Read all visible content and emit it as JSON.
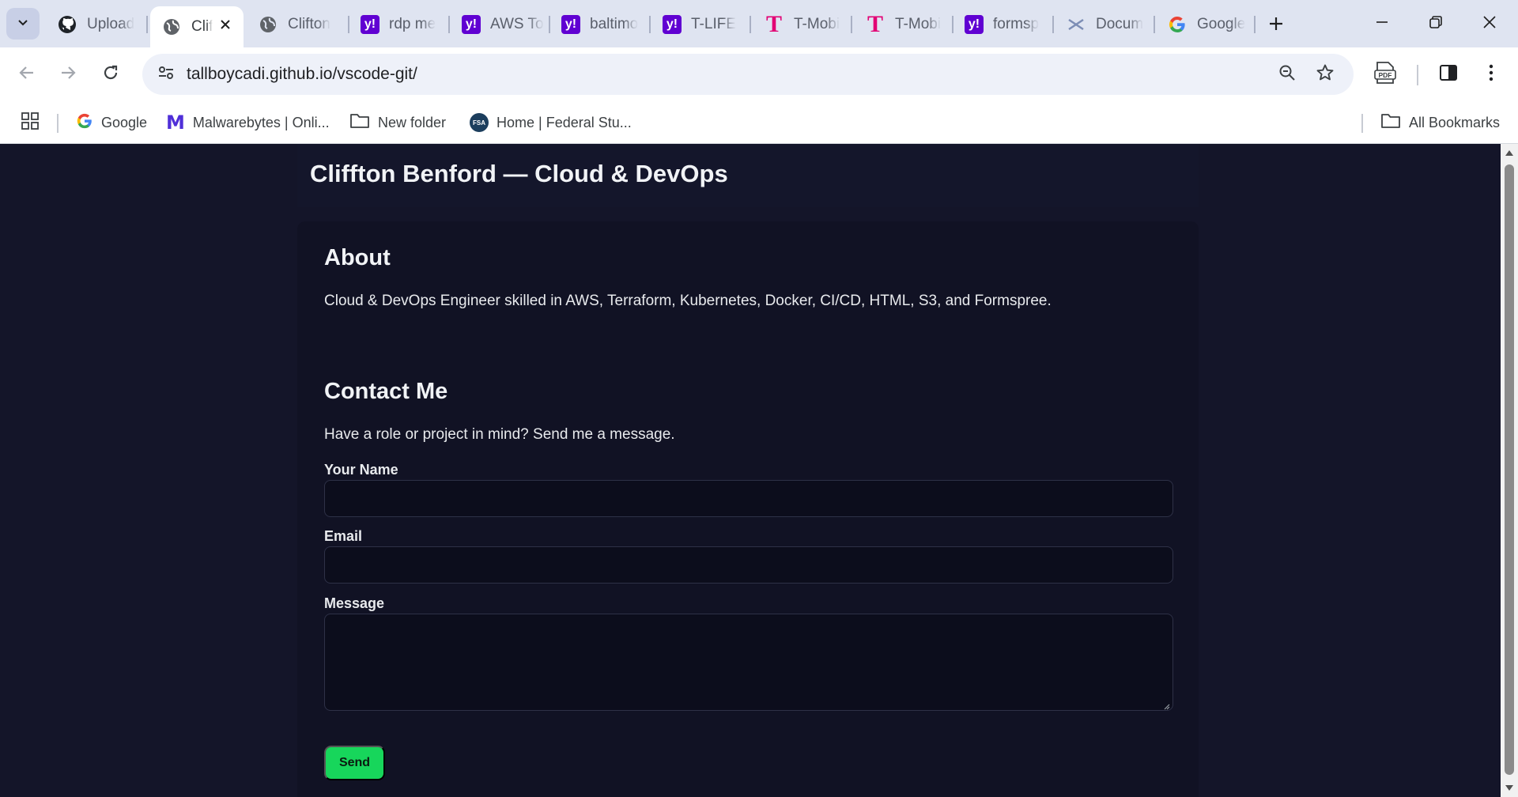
{
  "browser": {
    "tabs": [
      {
        "title": "Upload",
        "favicon": "github-icon",
        "active": false
      },
      {
        "title": "Clif",
        "favicon": "globe-icon",
        "active": true
      },
      {
        "title": "Clifton",
        "favicon": "globe-icon",
        "active": false
      },
      {
        "title": "rdp me",
        "favicon": "yahoo-icon",
        "active": false
      },
      {
        "title": "AWS To",
        "favicon": "yahoo-icon",
        "active": false
      },
      {
        "title": "baltimo",
        "favicon": "yahoo-icon",
        "active": false
      },
      {
        "title": "T-LIFE",
        "favicon": "yahoo-icon",
        "active": false
      },
      {
        "title": "T-Mobi",
        "favicon": "t-mobile-icon",
        "active": false
      },
      {
        "title": "T-Mobi",
        "favicon": "t-mobile-icon",
        "active": false
      },
      {
        "title": "formsp",
        "favicon": "yahoo-icon",
        "active": false
      },
      {
        "title": "Docum",
        "favicon": "document-icon",
        "active": false
      },
      {
        "title": "Google",
        "favicon": "google-icon",
        "active": false
      }
    ],
    "address_bar": {
      "url": "tallboycadi.github.io/vscode-git/"
    },
    "bookmarks": [
      {
        "label": "Google",
        "icon": "google-icon"
      },
      {
        "label": "Malwarebytes | Onli...",
        "icon": "malwarebytes-icon"
      },
      {
        "label": "New folder",
        "icon": "folder-icon"
      },
      {
        "label": "Home | Federal Stu...",
        "icon": "fsa-icon"
      }
    ],
    "all_bookmarks_label": "All Bookmarks",
    "fsa_badge_text": "FSA",
    "yahoo_glyph": "y!",
    "tmobile_glyph": "T"
  },
  "page": {
    "site_title": "Cliffton Benford — Cloud & DevOps",
    "about": {
      "heading": "About",
      "text": "Cloud & DevOps Engineer skilled in AWS, Terraform, Kubernetes, Docker, CI/CD, HTML, S3, and Formspree."
    },
    "contact": {
      "heading": "Contact Me",
      "intro": "Have a role or project in mind? Send me a message.",
      "name_label": "Your Name",
      "name_value": "",
      "email_label": "Email",
      "email_value": "",
      "message_label": "Message",
      "message_value": "",
      "send_label": "Send"
    }
  },
  "colors": {
    "page_background": "#141529",
    "card_background": "#111224",
    "send_button": "#17d65b",
    "browser_chrome": "#dfe4f1"
  }
}
